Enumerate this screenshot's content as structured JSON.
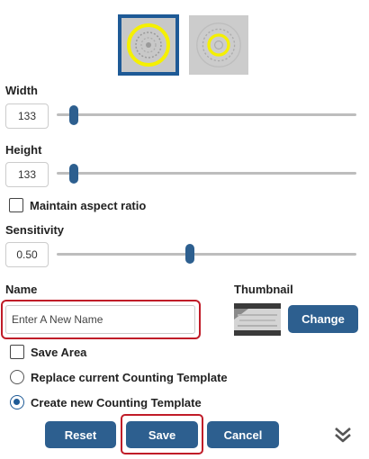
{
  "templates": {
    "selected_icon": "yellow-ring-template-icon",
    "other_icon": "yellow-ring-template-icon"
  },
  "width": {
    "label": "Width",
    "value": "133",
    "level": 0.05
  },
  "height": {
    "label": "Height",
    "value": "133",
    "level": 0.05
  },
  "aspect": {
    "label": "Maintain aspect ratio",
    "checked": false
  },
  "sensitivity": {
    "label": "Sensitivity",
    "value": "0.50",
    "level": 0.5
  },
  "name": {
    "label": "Name",
    "placeholder": "Enter A New Name"
  },
  "thumbnail": {
    "label": "Thumbnail",
    "change_label": "Change"
  },
  "save_area": {
    "label": "Save Area",
    "checked": false
  },
  "mode": {
    "replace_label": "Replace current Counting Template",
    "create_label": "Create new Counting Template",
    "selected": "create"
  },
  "actions": {
    "reset": "Reset",
    "save": "Save",
    "cancel": "Cancel"
  },
  "colors": {
    "accent": "#2d5f8f",
    "highlight": "#c01c28",
    "template_ring": "#f5f000"
  }
}
